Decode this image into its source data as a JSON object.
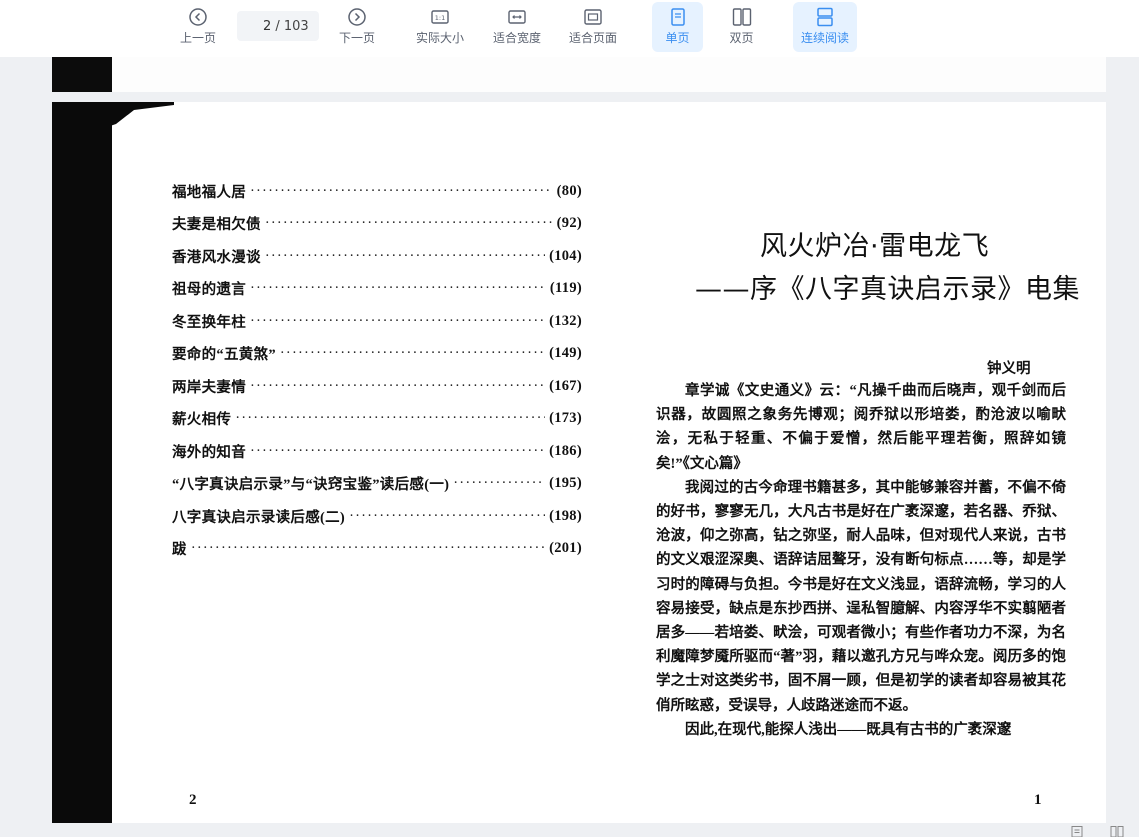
{
  "toolbar": {
    "prev_label": "上一页",
    "next_label": "下一页",
    "current_page": "2",
    "total_pages": "/ 103",
    "actual_size_label": "实际大小",
    "fit_width_label": "适合宽度",
    "fit_page_label": "适合页面",
    "single_page_label": "单页",
    "double_page_label": "双页",
    "continuous_label": "连续阅读",
    "accent_color": "#3a8ef0"
  },
  "left_page": {
    "toc": [
      {
        "title": "福地福人居",
        "page": "(80)"
      },
      {
        "title": "夫妻是相欠债",
        "page": "(92)"
      },
      {
        "title": "香港风水漫谈",
        "page": "(104)"
      },
      {
        "title": "祖母的遗言",
        "page": "(119)"
      },
      {
        "title": "冬至换年柱",
        "page": "(132)"
      },
      {
        "title": "要命的“五黄煞”",
        "page": "(149)"
      },
      {
        "title": "两岸夫妻情",
        "page": "(167)"
      },
      {
        "title": "薪火相传",
        "page": "(173)"
      },
      {
        "title": "海外的知音",
        "page": "(186)"
      },
      {
        "title": "“八字真诀启示录”与“诀窍宝鉴”读后感(一)",
        "page": "(195)"
      },
      {
        "title": "八字真诀启示录读后感(二)",
        "page": "(198)"
      },
      {
        "title": "跋",
        "page": "(201)"
      }
    ],
    "page_number": "2"
  },
  "right_page": {
    "title_line1": "风火炉冶·雷电龙飞",
    "title_line2": "——序《八字真诀启示录》电集",
    "author": "钟义明",
    "paragraphs": [
      "章学诚《文史通义》云：“凡操千曲而后晓声，观千剑而后识器，故圆照之象务先博观；阅乔狱以形培娄，酌沧波以喻畎浍，无私于轻重、不偏于爱憎，然后能平理若衡，照辞如镜矣!”《文心篇》",
      "我阅过的古今命理书籍甚多，其中能够兼容并蓄，不偏不倚的好书，寥寥无几，大凡古书是好在广袤深邃，若名器、乔狱、沧波，仰之弥高，钻之弥坚，耐人品味，但对现代人来说，古书的文义艰涩深奥、语辞诘屈聱牙，没有断句标点……等，却是学习时的障碍与负担。今书是好在文义浅显，语辞流畅，学习的人容易接受，缺点是东抄西拼、逞私智臆解、内容浮华不实翦陋者居多——若培娄、畎浍，可观者微小；有些作者功力不深，为名利魔障梦魇所驱而“著”羽，藉以邀孔方兄与哗众宠。阅历多的饱学之士对这类劣书，固不屑一顾，但是初学的读者却容易被其花俏所眩惑，受误导，人歧路迷途而不返。",
      "因此,在现代,能探人浅出——既具有古书的广袤深邃"
    ],
    "page_number": "1"
  }
}
